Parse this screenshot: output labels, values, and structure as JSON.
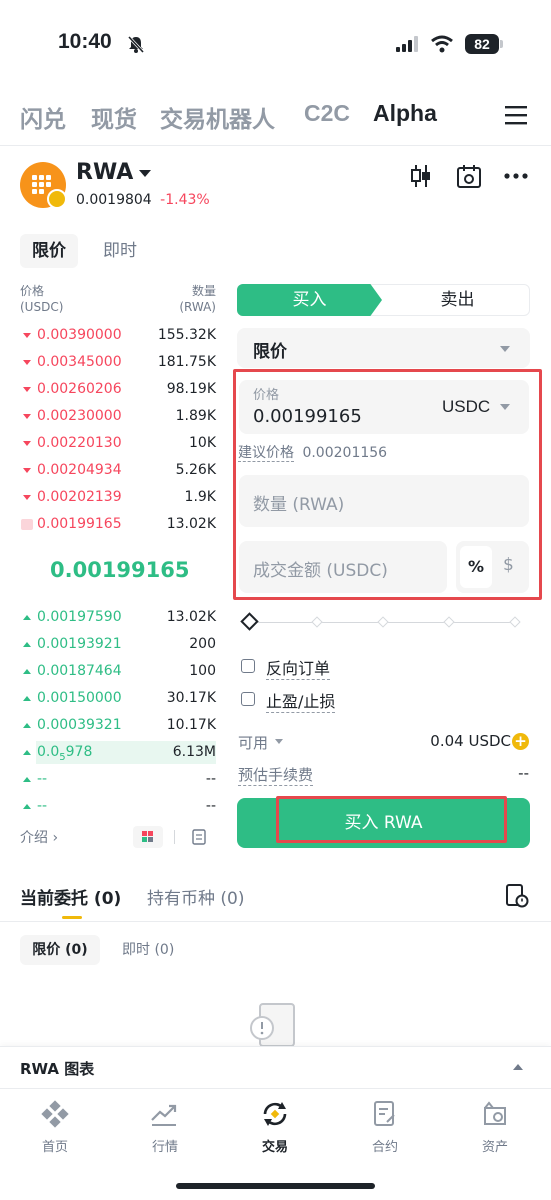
{
  "status_bar": {
    "time": "10:40",
    "battery": "82"
  },
  "top_tabs": [
    {
      "label": "闪兑"
    },
    {
      "label": "现货"
    },
    {
      "label": "交易机器人"
    },
    {
      "label": "C2C"
    },
    {
      "label": "Alpha",
      "active": true
    }
  ],
  "header": {
    "pair": "RWA",
    "price": "0.0019804",
    "change": "-1.43%"
  },
  "order_type_tabs": {
    "limit": "限价",
    "market": "即时"
  },
  "order_book": {
    "price_header": "价格",
    "price_unit": "(USDC)",
    "qty_header": "数量",
    "qty_unit": "(RWA)",
    "asks": [
      {
        "price": "0.00390000",
        "qty": "155.32K"
      },
      {
        "price": "0.00345000",
        "qty": "181.75K"
      },
      {
        "price": "0.00260206",
        "qty": "98.19K"
      },
      {
        "price": "0.00230000",
        "qty": "1.89K"
      },
      {
        "price": "0.00220130",
        "qty": "10K"
      },
      {
        "price": "0.00204934",
        "qty": "5.26K"
      },
      {
        "price": "0.00202139",
        "qty": "1.9K"
      },
      {
        "price": "0.00199165",
        "qty": "13.02K"
      }
    ],
    "last_price": "0.00199165",
    "bids": [
      {
        "price": "0.00197590",
        "qty": "13.02K"
      },
      {
        "price": "0.00193921",
        "qty": "200"
      },
      {
        "price": "0.00187464",
        "qty": "100"
      },
      {
        "price": "0.00150000",
        "qty": "30.17K"
      },
      {
        "price": "0.00039321",
        "qty": "10.17K"
      },
      {
        "price": "0.0",
        "price_sub": "5",
        "price_tail": "978",
        "qty": "6.13M"
      },
      {
        "price": "--",
        "qty": "--"
      },
      {
        "price": "--",
        "qty": "--"
      }
    ],
    "intro": "介绍 ›"
  },
  "trade_form": {
    "buy_tab": "买入",
    "sell_tab": "卖出",
    "order_type": "限价",
    "price_label": "价格",
    "price_value": "0.00199165",
    "price_currency": "USDC",
    "suggested_label": "建议价格",
    "suggested_value": "0.00201156",
    "qty_placeholder": "数量 (RWA)",
    "amount_placeholder": "成交金额 (USDC)",
    "pct_toggle": "%",
    "usd_toggle": "$",
    "reverse_order": "反向订单",
    "tp_sl": "止盈/止损",
    "available_label": "可用",
    "available_value": "0.04 USDC",
    "fee_label": "预估手续费",
    "fee_value": "--",
    "buy_button": "买入 RWA"
  },
  "orders": {
    "tab_current": "当前委托 (0)",
    "tab_holdings": "持有币种 (0)",
    "filter_limit": "限价 (0)",
    "filter_market": "即时 (0)"
  },
  "chart_bar": {
    "label": "RWA 图表"
  },
  "bottom_nav": [
    {
      "label": "首页",
      "icon": "home-icon"
    },
    {
      "label": "行情",
      "icon": "markets-icon"
    },
    {
      "label": "交易",
      "icon": "trade-icon",
      "active": true
    },
    {
      "label": "合约",
      "icon": "futures-icon"
    },
    {
      "label": "资产",
      "icon": "wallet-icon"
    }
  ],
  "colors": {
    "green": "#2ebd85",
    "red": "#f6465d",
    "accent": "#f0b90b"
  }
}
